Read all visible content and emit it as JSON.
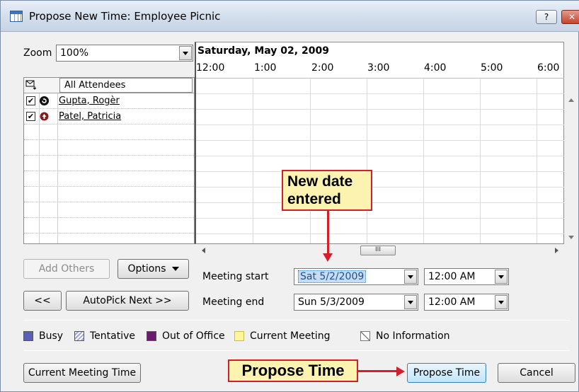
{
  "window": {
    "title": "Propose New Time:  Employee Picnic",
    "help_label": "?",
    "close_label": "✕"
  },
  "zoom": {
    "label": "Zoom",
    "value": "100%"
  },
  "schedule": {
    "date": "Saturday, May 02, 2009",
    "times": [
      "12:00",
      "1:00",
      "2:00",
      "3:00",
      "4:00",
      "5:00",
      "6:00"
    ],
    "scroll_thumb": "III"
  },
  "attendees": {
    "header": "All Attendees",
    "list": [
      {
        "name": "Gupta, Rogèr",
        "checked": "✔",
        "icon": "organizer-icon"
      },
      {
        "name": "Patel, Patricia",
        "checked": "✔",
        "icon": "required-attendee-icon"
      }
    ]
  },
  "buttons": {
    "add_others": "Add Others",
    "options": "Options",
    "prev": "<<",
    "autopick": "AutoPick Next >>",
    "current_meeting_time": "Current Meeting Time",
    "propose_time": "Propose Time",
    "cancel": "Cancel"
  },
  "meeting": {
    "start_label": "Meeting start",
    "end_label": "Meeting end",
    "start_date": "Sat 5/2/2009",
    "start_time": "12:00 AM",
    "end_date": "Sun 5/3/2009",
    "end_time": "12:00 AM"
  },
  "legend": {
    "busy": "Busy",
    "tentative": "Tentative",
    "out_of_office": "Out of Office",
    "current_meeting": "Current Meeting",
    "no_information": "No Information",
    "colors": {
      "busy": "#5a5fb8",
      "tentative": "#9fa6e0",
      "out_of_office": "#6b1a6e",
      "current_meeting": "#fff59a"
    }
  },
  "callouts": {
    "new_date": [
      "New date",
      "entered"
    ],
    "propose_time": "Propose Time"
  },
  "colors": {
    "callout_bg": "#fdf3b1",
    "callout_border": "#d21f2a"
  }
}
